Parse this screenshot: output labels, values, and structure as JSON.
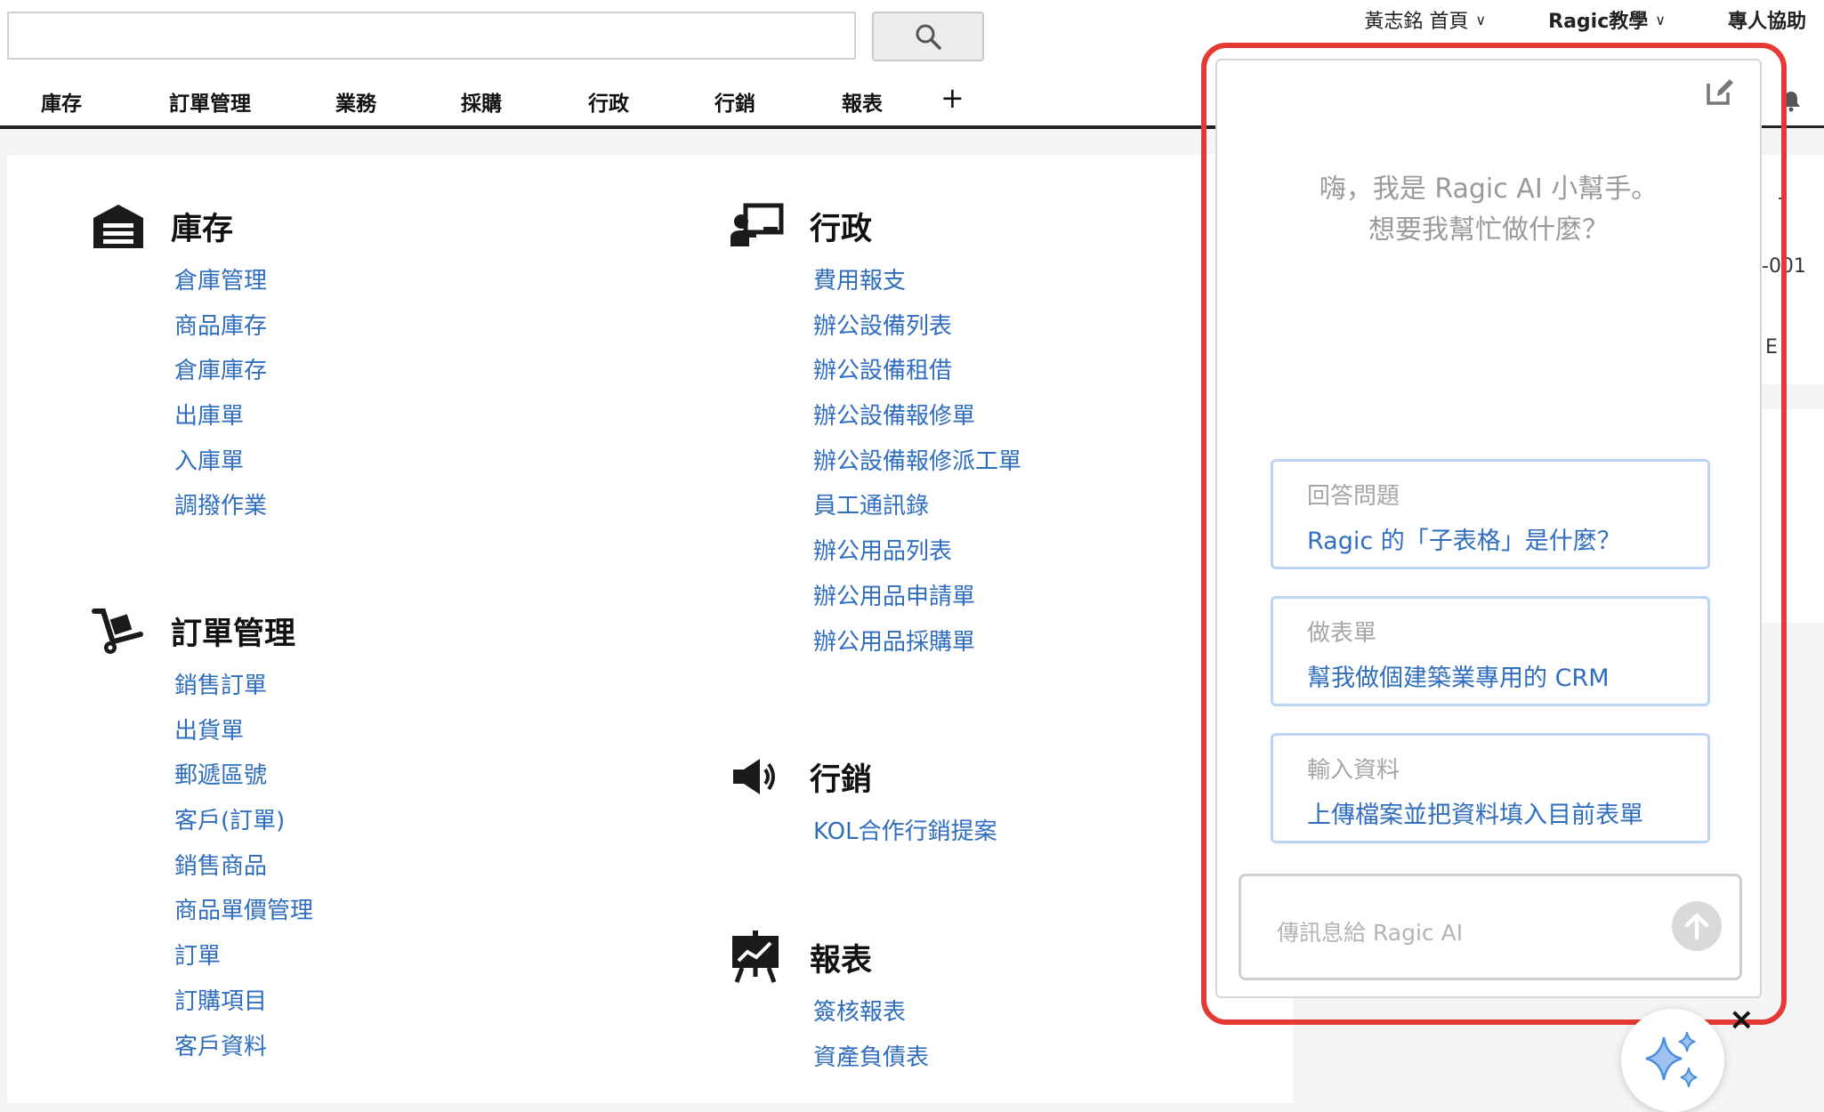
{
  "header": {
    "search_placeholder": "",
    "user_menu": "黃志銘 首頁",
    "tutorial_menu": "Ragic教學",
    "help": "專人協助"
  },
  "nav": {
    "tabs": [
      "庫存",
      "訂單管理",
      "業務",
      "採購",
      "行政",
      "行銷",
      "報表"
    ],
    "add": "+"
  },
  "sections": {
    "inventory": {
      "title": "庫存",
      "icon": "warehouse-icon",
      "items": [
        "倉庫管理",
        "商品庫存",
        "倉庫庫存",
        "出庫單",
        "入庫單",
        "調撥作業"
      ]
    },
    "orders": {
      "title": "訂單管理",
      "icon": "hand-truck-icon",
      "items": [
        "銷售訂單",
        "出貨單",
        "郵遞區號",
        "客戶(訂單)",
        "銷售商品",
        "商品單價管理",
        "訂單",
        "訂購項目",
        "客戶資料"
      ]
    },
    "admin": {
      "title": "行政",
      "icon": "presenter-icon",
      "items": [
        "費用報支",
        "辦公設備列表",
        "辦公設備租借",
        "辦公設備報修單",
        "辦公設備報修派工單",
        "員工通訊錄",
        "辦公用品列表",
        "辦公用品申請單",
        "辦公用品採購單"
      ]
    },
    "marketing": {
      "title": "行銷",
      "icon": "megaphone-icon",
      "items": [
        "KOL合作行銷提案"
      ]
    },
    "reports": {
      "title": "報表",
      "icon": "chart-board-icon",
      "items": [
        "簽核報表",
        "資產負債表"
      ]
    }
  },
  "chat": {
    "greeting_line1": "嗨，我是 Ragic AI 小幫手。",
    "greeting_line2": "想要我幫忙做什麼？",
    "suggestions": [
      {
        "category": "回答問題",
        "question": "Ragic 的「子表格」是什麼？"
      },
      {
        "category": "做表單",
        "question": "幫我做個建築業專用的 CRM"
      },
      {
        "category": "輸入資料",
        "question": "上傳檔案並把資料填入目前表單"
      }
    ],
    "input_placeholder": "傳訊息給 Ragic AI",
    "close": "×"
  },
  "edge_fragments": [
    "-",
    "-001",
    "E"
  ],
  "colors": {
    "link": "#2f6dbf",
    "highlight": "#e53935",
    "suggest_border": "#bcd4f2"
  }
}
